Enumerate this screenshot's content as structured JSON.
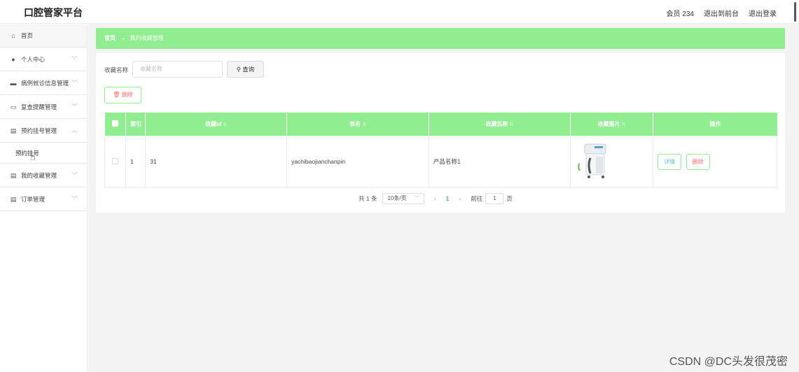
{
  "header": {
    "title": "口腔管家平台",
    "member": "会员 234",
    "to_front": "退出到前台",
    "logout": "退出登录"
  },
  "sidebar": {
    "items": [
      {
        "label": "首页",
        "icon": "home-icon"
      },
      {
        "label": "个人中心",
        "icon": "user-icon"
      },
      {
        "label": "病例就诊信息管理",
        "icon": "message-icon"
      },
      {
        "label": "复查提醒管理",
        "icon": "chart-icon"
      },
      {
        "label": "预约挂号管理",
        "icon": "document-icon"
      },
      {
        "label": "预约挂号",
        "icon": ""
      },
      {
        "label": "我的收藏管理",
        "icon": "document-icon"
      },
      {
        "label": "订单管理",
        "icon": "document-icon"
      }
    ]
  },
  "breadcrumb": {
    "home": "首页",
    "arrow": "→",
    "current": "我的收藏管理"
  },
  "search": {
    "label": "收藏名称",
    "placeholder": "收藏名称",
    "button": "查询"
  },
  "toolbar": {
    "delete_label": "删除"
  },
  "table": {
    "headers": [
      "索引",
      "收藏id",
      "表名",
      "收藏名称",
      "收藏图片",
      "操作"
    ],
    "rows": [
      {
        "index": "1",
        "fav_id": "31",
        "table_name": "yachibaojianchanpin",
        "fav_name": "产品名称1",
        "detail": "详情",
        "delete": "删除"
      }
    ]
  },
  "pager": {
    "total": "共 1 条",
    "page_size": "10条/页",
    "current_page": "1",
    "goto_label": "前往",
    "goto_value": "1",
    "page_unit": "页"
  },
  "watermark": "CSDN @DC头发很茂密",
  "colors": {
    "accent": "#90ee90",
    "danger": "#f56c6c"
  }
}
